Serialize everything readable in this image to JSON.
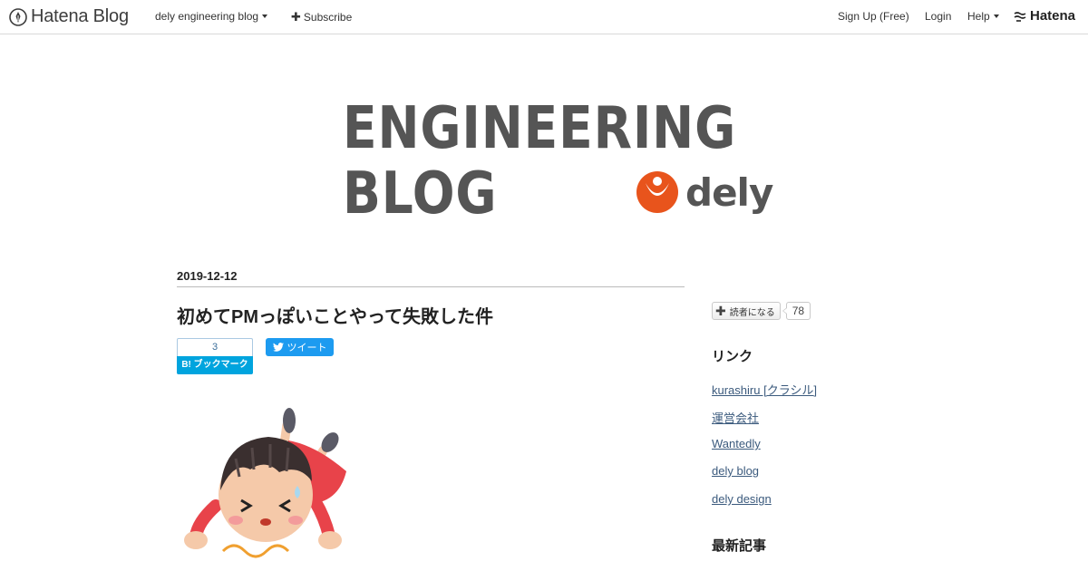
{
  "topbar": {
    "brand": "Hatena Blog",
    "blog_menu": "dely engineering blog",
    "subscribe": "Subscribe",
    "signup": "Sign Up (Free)",
    "login": "Login",
    "help": "Help",
    "hatena": "Hatena"
  },
  "header": {
    "line1": "ENGINEERING",
    "line2": "BLOG",
    "company": "dely",
    "brand_color": "#e8541c",
    "text_color": "#555555"
  },
  "entry": {
    "date": "2019-12-12",
    "title": "初めてPMっぽいことやって失敗した件",
    "bookmark_count": "3",
    "bookmark_label": "B! ブックマーク",
    "tweet_label": "ツイート"
  },
  "sidebar": {
    "subscribe_label": "読者になる",
    "subscriber_count": "78",
    "links_heading": "リンク",
    "links": [
      "kurashiru [クラシル]",
      "運営会社",
      "Wantedly",
      "dely blog",
      "dely design"
    ],
    "recent_heading": "最新記事"
  },
  "icons": {
    "brand": "hatena-blog-pen-icon",
    "hatena": "hatena-logo-icon",
    "tweet": "twitter-bird-icon"
  }
}
